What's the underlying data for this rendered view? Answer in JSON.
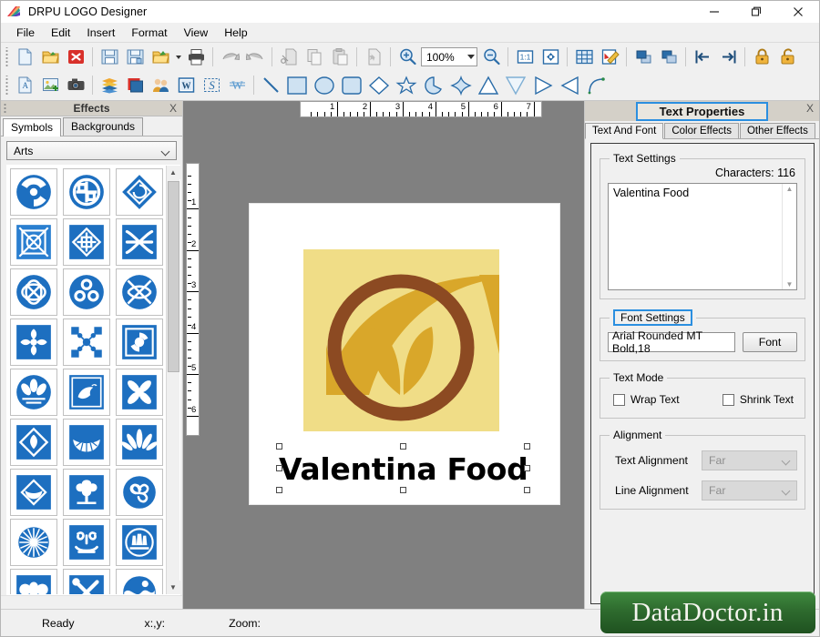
{
  "window": {
    "title": "DRPU LOGO Designer",
    "icon": "app-logo-icon",
    "controls": {
      "minimize": "minimize-icon",
      "maximize": "maximize-icon",
      "close": "close-icon"
    }
  },
  "menubar": {
    "items": [
      {
        "label": "File"
      },
      {
        "label": "Edit"
      },
      {
        "label": "Insert"
      },
      {
        "label": "Format"
      },
      {
        "label": "View"
      },
      {
        "label": "Help"
      }
    ]
  },
  "toolbar": {
    "row1": [
      {
        "name": "new-document-icon",
        "title": "New"
      },
      {
        "name": "open-folder-icon",
        "title": "Open"
      },
      {
        "name": "close-document-icon",
        "title": "Close"
      },
      {
        "sep": true
      },
      {
        "name": "save-icon",
        "title": "Save"
      },
      {
        "name": "save-as-icon",
        "title": "Save As"
      },
      {
        "name": "export-folder-icon",
        "title": "Export"
      },
      {
        "name": "print-icon",
        "title": "Print"
      },
      {
        "sep": true
      },
      {
        "name": "undo-icon",
        "title": "Undo"
      },
      {
        "name": "redo-icon",
        "title": "Redo"
      },
      {
        "sep": true
      },
      {
        "name": "cut-icon",
        "title": "Cut"
      },
      {
        "name": "copy-icon",
        "title": "Copy"
      },
      {
        "name": "paste-icon",
        "title": "Paste"
      },
      {
        "sep": true
      },
      {
        "name": "delete-icon",
        "title": "Delete"
      },
      {
        "sep": true
      },
      {
        "name": "zoom-in-icon",
        "title": "Zoom In"
      },
      {
        "name": "zoom-level-combo",
        "title": "Zoom Level"
      },
      {
        "name": "zoom-out-icon",
        "title": "Zoom Out"
      },
      {
        "sep": true
      },
      {
        "name": "actual-size-icon",
        "title": "1:1"
      },
      {
        "name": "fit-page-icon",
        "title": "Fit Page"
      },
      {
        "sep": true
      },
      {
        "name": "grid-icon",
        "title": "Grid"
      },
      {
        "name": "edit-page-icon",
        "title": "Edit"
      },
      {
        "sep": true
      },
      {
        "name": "bring-to-front-icon",
        "title": "Bring To Front"
      },
      {
        "name": "send-to-back-icon",
        "title": "Send To Back"
      },
      {
        "sep": true
      },
      {
        "name": "align-left-icon",
        "title": "Align Left"
      },
      {
        "name": "align-right-icon",
        "title": "Align Right"
      },
      {
        "sep": true
      },
      {
        "name": "lock-icon",
        "title": "Lock"
      },
      {
        "name": "unlock-icon",
        "title": "Unlock"
      }
    ],
    "row2": [
      {
        "name": "insert-text-icon",
        "title": "Insert Text"
      },
      {
        "name": "insert-image-icon",
        "title": "Insert Image"
      },
      {
        "name": "camera-capture-icon",
        "title": "Capture"
      },
      {
        "sep": true
      },
      {
        "name": "layers-icon",
        "title": "Layers"
      },
      {
        "name": "color-palette-icon",
        "title": "Palette"
      },
      {
        "name": "contacts-icon",
        "title": "Contacts"
      },
      {
        "name": "word-art-icon",
        "title": "Word Art"
      },
      {
        "name": "signature-icon",
        "title": "Signature"
      },
      {
        "name": "watermark-icon",
        "title": "Watermark"
      },
      {
        "sep": true
      },
      {
        "name": "line-tool-icon",
        "title": "Line"
      },
      {
        "name": "rectangle-tool-icon",
        "title": "Rectangle"
      },
      {
        "name": "ellipse-tool-icon",
        "title": "Ellipse"
      },
      {
        "name": "rounded-rect-tool-icon",
        "title": "Rounded Rectangle"
      },
      {
        "name": "diamond-tool-icon",
        "title": "Diamond"
      },
      {
        "name": "star-tool-icon",
        "title": "Star"
      },
      {
        "name": "pie-tool-icon",
        "title": "Pie"
      },
      {
        "name": "four-point-star-tool-icon",
        "title": "4-Point Star"
      },
      {
        "name": "triangle-up-tool-icon",
        "title": "Triangle Up"
      },
      {
        "name": "triangle-down-tool-icon",
        "title": "Triangle Down"
      },
      {
        "name": "triangle-right-tool-icon",
        "title": "Triangle Right"
      },
      {
        "name": "triangle-left-tool-icon",
        "title": "Triangle Left"
      },
      {
        "name": "arc-tool-icon",
        "title": "Arc"
      }
    ],
    "zoom_value": "100%"
  },
  "left_dock": {
    "title": "Effects",
    "close_label": "X",
    "tabs": [
      {
        "label": "Symbols",
        "active": true
      },
      {
        "label": "Backgrounds",
        "active": false
      }
    ],
    "category": "Arts",
    "symbols": [
      "triple-swirl-symbol",
      "knot-circle-symbol",
      "diamond-spiral-symbol",
      "celtic-cross-square-symbol",
      "celtic-diamond-cross-symbol",
      "interlace-x-symbol",
      "oval-knot-symbol",
      "clover-knot-symbol",
      "woven-x-circle-symbol",
      "floral-cross-symbol",
      "node-network-symbol",
      "spiral-square-symbol",
      "lotus-crest-symbol",
      "crane-bird-symbol",
      "leaf-burst-symbol",
      "diamond-leaf-symbol",
      "fan-shell-symbol",
      "palm-leaf-symbol",
      "diamond-fan-symbol",
      "oak-tree-symbol",
      "spiral-flower-circle-symbol",
      "radial-burst-symbol",
      "scroll-ornament-symbol",
      "crest-circle-symbol",
      "butterfly-crest-symbol",
      "crossed-tools-symbol",
      "wave-circle-symbol"
    ]
  },
  "canvas": {
    "h_ruler_ticks": [
      "1",
      "2",
      "3",
      "4",
      "5",
      "6",
      "7"
    ],
    "v_ruler_ticks": [
      "1",
      "2",
      "3",
      "4",
      "5",
      "6"
    ],
    "logo_text": "Valentina Food",
    "logo_colors": {
      "background": "#f0dd87",
      "accent": "#d9a72a",
      "ring": "#8c4a22"
    },
    "selected": true
  },
  "right_dock": {
    "title": "Text Properties",
    "close_label": "X",
    "tabs": [
      {
        "label": "Text And Font",
        "active": true
      },
      {
        "label": "Color Effects",
        "active": false
      },
      {
        "label": "Other Effects",
        "active": false
      }
    ],
    "text_settings": {
      "legend": "Text Settings",
      "characters_label": "Characters: 116",
      "value": "Valentina Food"
    },
    "font_settings": {
      "legend": "Font Settings",
      "font_value": "Arial Rounded MT Bold,18",
      "button_label": "Font"
    },
    "text_mode": {
      "legend": "Text Mode",
      "wrap_label": "Wrap Text",
      "wrap_checked": false,
      "shrink_label": "Shrink Text",
      "shrink_checked": false
    },
    "alignment": {
      "legend": "Alignment",
      "text_alignment_label": "Text Alignment",
      "text_alignment_value": "Far",
      "line_alignment_label": "Line Alignment",
      "line_alignment_value": "Far"
    },
    "highlight_color": "#2b8fe0"
  },
  "statusbar": {
    "ready": "Ready",
    "coords": "x:,y:",
    "zoom": "Zoom:"
  },
  "watermark": {
    "text": "DataDoctor.in",
    "color": "#2e6b2e"
  }
}
